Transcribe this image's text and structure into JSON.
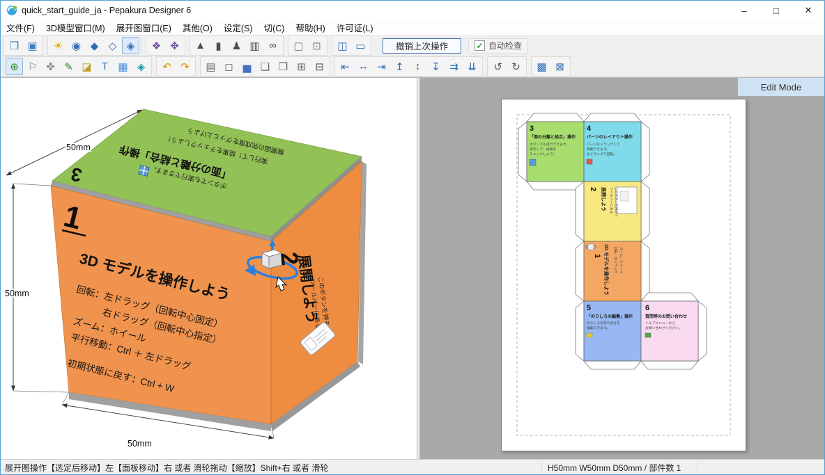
{
  "titlebar": {
    "title": "quick_start_guide_ja - Pepakura Designer 6",
    "minimize": "–",
    "maximize": "□",
    "close": "✕"
  },
  "menubar": {
    "items": [
      {
        "name": "menu-file",
        "label": "文件(F)"
      },
      {
        "name": "menu-3d-model-window",
        "label": "3D模型窗口(M)"
      },
      {
        "name": "menu-pattern-window",
        "label": "展开图窗口(E)"
      },
      {
        "name": "menu-others",
        "label": "其他(O)"
      },
      {
        "name": "menu-settings",
        "label": "设定(S)"
      },
      {
        "name": "menu-cut",
        "label": "切(C)"
      },
      {
        "name": "menu-help",
        "label": "帮助(H)"
      },
      {
        "name": "menu-license",
        "label": "许可证(L)"
      }
    ]
  },
  "toolbar_top": {
    "undo_label": "撤销上次操作",
    "autocheck_label": "自动检查",
    "check_glyph": "✓",
    "groups": [
      [
        {
          "name": "open-file-icon",
          "glyph": "❒",
          "color": "#3f7fbf"
        },
        {
          "name": "save-file-icon",
          "glyph": "▣",
          "color": "#3f7fbf"
        }
      ],
      [
        {
          "name": "light-bulb-icon",
          "glyph": "☀",
          "color": "#dca700"
        },
        {
          "name": "rotate-view-icon",
          "glyph": "◉",
          "color": "#2e6db4"
        },
        {
          "name": "shaded-view-icon",
          "glyph": "◆",
          "color": "#2e6db4"
        },
        {
          "name": "wireframe-view-icon",
          "glyph": "◇",
          "color": "#2e6db4"
        },
        {
          "name": "textured-view-icon",
          "glyph": "◈",
          "color": "#2e6db4",
          "pressed": true
        }
      ],
      [
        {
          "name": "fit-view-icon",
          "glyph": "❖",
          "color": "#6b4f9e"
        },
        {
          "name": "reset-view-icon",
          "glyph": "✥",
          "color": "#6b4f9e"
        }
      ],
      [
        {
          "name": "cone-display-icon",
          "glyph": "▲",
          "color": "#4d4d4d"
        },
        {
          "name": "cylinder-display-icon",
          "glyph": "▮",
          "color": "#4d4d4d"
        },
        {
          "name": "person-display-icon",
          "glyph": "♟",
          "color": "#4d4d4d"
        },
        {
          "name": "chart-display-icon",
          "glyph": "▥",
          "color": "#4d4d4d"
        },
        {
          "name": "link-display-icon",
          "glyph": "∞",
          "color": "#4d4d4d"
        }
      ],
      [
        {
          "name": "selection-frame-icon",
          "glyph": "▢",
          "color": "#7a7a7a"
        },
        {
          "name": "selection-settings-icon",
          "glyph": "⊡",
          "color": "#7a7a7a"
        }
      ],
      [
        {
          "name": "two-pane-layout-icon",
          "glyph": "◫",
          "color": "#2e6db4"
        },
        {
          "name": "single-pane-layout-icon",
          "glyph": "▭",
          "color": "#2e6db4"
        }
      ]
    ]
  },
  "toolbar_edit": {
    "groups": [
      [
        {
          "name": "zoom-icon",
          "glyph": "⊕",
          "color": "#2e8b2e",
          "pressed": true
        },
        {
          "name": "tag-icon",
          "glyph": "⚐",
          "color": "#777777"
        },
        {
          "name": "pan-icon",
          "glyph": "✜",
          "color": "#777777"
        },
        {
          "name": "pen-icon",
          "glyph": "✎",
          "color": "#2e8b2e"
        },
        {
          "name": "eraser-icon",
          "glyph": "◪",
          "color": "#b8a22e"
        },
        {
          "name": "text-icon",
          "glyph": "T",
          "color": "#2e6db4"
        },
        {
          "name": "image-icon",
          "glyph": "▦",
          "color": "#4a90d9"
        },
        {
          "name": "cube-icon",
          "glyph": "◈",
          "color": "#1a9baa"
        }
      ],
      [
        {
          "name": "undo-icon",
          "glyph": "↶",
          "color": "#d99800"
        },
        {
          "name": "redo-icon",
          "glyph": "↷",
          "color": "#d99800"
        }
      ],
      [
        {
          "name": "book-icon",
          "glyph": "▤",
          "color": "#6b6b6b"
        },
        {
          "name": "monitor-icon",
          "glyph": "◻",
          "color": "#6b6b6b"
        },
        {
          "name": "columns-icon",
          "glyph": "▅",
          "color": "#4472c4"
        },
        {
          "name": "document-icon",
          "glyph": "❑",
          "color": "#6b6b6b"
        },
        {
          "name": "document-export-icon",
          "glyph": "❒",
          "color": "#6b6b6b"
        },
        {
          "name": "document-settings-icon",
          "glyph": "⊞",
          "color": "#6b6b6b"
        },
        {
          "name": "print-icon",
          "glyph": "⊟",
          "color": "#555555"
        }
      ],
      [
        {
          "name": "align-left-icon",
          "glyph": "⇤",
          "color": "#2e6db4"
        },
        {
          "name": "align-center-horizontal-icon",
          "glyph": "↔",
          "color": "#2e6db4"
        },
        {
          "name": "align-right-icon",
          "glyph": "⇥",
          "color": "#2e6db4"
        },
        {
          "name": "align-top-icon",
          "glyph": "↥",
          "color": "#2e6db4"
        },
        {
          "name": "align-center-vertical-icon",
          "glyph": "↕",
          "color": "#2e6db4"
        },
        {
          "name": "align-bottom-icon",
          "glyph": "↧",
          "color": "#2e6db4"
        },
        {
          "name": "distribute-horizontal-icon",
          "glyph": "⇉",
          "color": "#2e6db4"
        },
        {
          "name": "distribute-vertical-icon",
          "glyph": "⇊",
          "color": "#2e6db4"
        }
      ],
      [
        {
          "name": "rotate-left-icon",
          "glyph": "↺",
          "color": "#555555"
        },
        {
          "name": "rotate-right-icon",
          "glyph": "↻",
          "color": "#555555"
        }
      ],
      [
        {
          "name": "check-parts-icon",
          "glyph": "▩",
          "color": "#2e6db4"
        },
        {
          "name": "arrange-parts-icon",
          "glyph": "⊠",
          "color": "#2e6db4"
        }
      ]
    ]
  },
  "view3d": {
    "dim_top": "50mm",
    "dim_left": "50mm",
    "dim_bottom": "50mm",
    "front": {
      "number": "1",
      "title": "3D モデルを操作しよう",
      "lines": [
        "回転：左ドラッグ（回転中心固定）",
        "　　　右ドラッグ（回転中心指定）",
        "ズーム：ホイール",
        "平行移動：Ctrl ＋ 左ドラッグ",
        "初期状態に戻す：Ctrl + W"
      ]
    },
    "side": {
      "number": "2",
      "title": "展開しよう",
      "lines": [
        "ツールバーにある",
        "このボタンを押そう"
      ]
    },
    "top": {
      "number": "3",
      "title": "「面の分離と結合」操作",
      "lines": [
        "ボタンでも実行できます。",
        "実行して！結果をチェックしよう！",
        "展開図の完成度をグッと上げよう"
      ]
    }
  },
  "page2d": {
    "edit_mode_label": "Edit Mode",
    "faces": {
      "f1": {
        "number": "1",
        "title": "3D モデルを操作しよう",
        "lines": [
          "回転：左ドラッグ",
          "ズーム：ホイール"
        ]
      },
      "f2": {
        "number": "2",
        "title": "展開しよう",
        "lines": [
          "ツールバーにある",
          "このボタンを押そう"
        ]
      },
      "f3": {
        "number": "3",
        "title": "「面の分離と結合」操作",
        "lines": [
          "ボタンでも実行できます。",
          "実行して！結果を",
          "チェックしよう！"
        ]
      },
      "f4": {
        "number": "4",
        "title": "パーツのレイアウト操作",
        "lines": [
          "パーツをドラッグして",
          "移動できます。",
          "右ドラッグで回転。"
        ]
      },
      "f5": {
        "number": "5",
        "title": "「のりしろの編集」操作",
        "lines": [
          "のりしろの形や長さを",
          "編集できます。"
        ]
      },
      "f6": {
        "number": "6",
        "title": "質問等のお問い合わせ",
        "lines": [
          "ヘルプメニューから",
          "お問い合わせください。"
        ]
      }
    }
  },
  "statusbar": {
    "left": "展开图操作【选定后移动】左【面板移动】右 或者 滑轮拖动【缩放】Shift+右 或者 滑轮",
    "right": "H50mm W50mm D50mm / 部件数 1"
  },
  "colors": {
    "cube_front": "#f0934e",
    "cube_side": "#ee8c42",
    "cube_top": "#92c156",
    "face_green": "#a8de6e",
    "face_cyan": "#7fdbe9",
    "face_yellow": "#f7e97f",
    "face_orange": "#f4a763",
    "face_blue": "#97b8f2",
    "face_pink": "#f9daf1",
    "edit_mode_bg": "#cfe2f4"
  }
}
